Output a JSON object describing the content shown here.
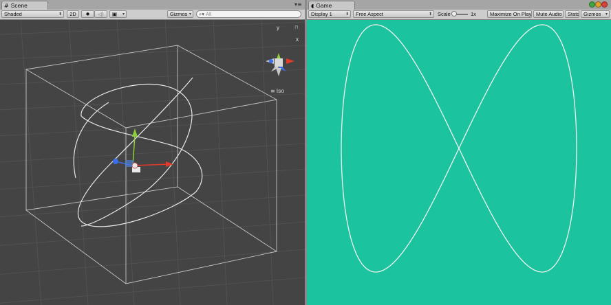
{
  "scene_panel": {
    "tab": {
      "title": "Scene",
      "icon": "grid-icon"
    },
    "toolbar": {
      "shading_mode": "Shaded",
      "mode_2d": "2D",
      "gizmos_label": "Gizmos",
      "search_text": "All"
    },
    "orientation_mode": "Iso",
    "gizmo_y_label": "y",
    "gizmo_x_label": "x"
  },
  "game_panel": {
    "tab": {
      "title": "Game",
      "icon": "pacman-icon"
    },
    "toolbar": {
      "display": "Display 1",
      "aspect": "Free Aspect",
      "scale_label": "Scale",
      "scale_value": "1x",
      "maximize_on_play": "Maximize On Play",
      "mute_audio": "Mute Audio",
      "stats": "Stats",
      "gizmos_label": "Gizmos"
    },
    "background_color": "#1bc49e"
  },
  "colors": {
    "scene_bg": "#444444",
    "axis_x": "#e23b2a",
    "axis_y": "#8ad13a",
    "axis_z": "#3a6ee8"
  }
}
